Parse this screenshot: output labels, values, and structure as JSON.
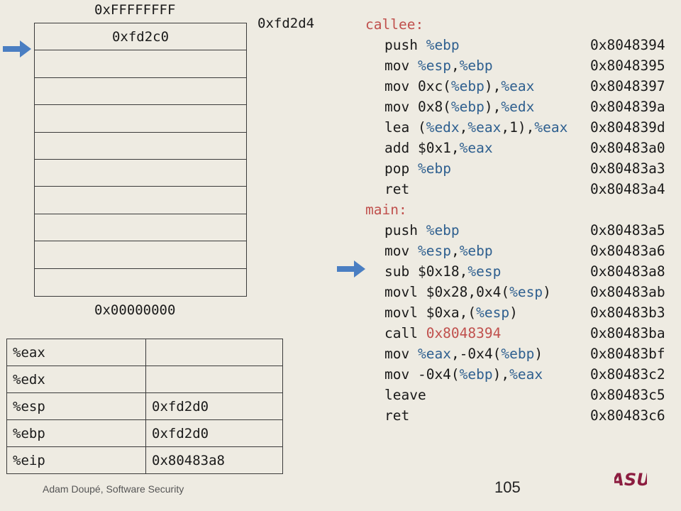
{
  "stack": {
    "top_label": "0xFFFFFFFF",
    "bottom_label": "0x00000000",
    "pointer_label": "0xfd2d4",
    "cells": [
      "0xfd2c0",
      "",
      "",
      "",
      "",
      "",
      "",
      "",
      "",
      ""
    ],
    "arrow_color": "#4a7ec2"
  },
  "registers": [
    {
      "name": "%eax",
      "value": ""
    },
    {
      "name": "%edx",
      "value": ""
    },
    {
      "name": "%esp",
      "value": "0xfd2d0"
    },
    {
      "name": "%ebp",
      "value": "0xfd2d0"
    },
    {
      "name": "%eip",
      "value": "0x80483a8"
    }
  ],
  "code": [
    {
      "type": "label",
      "text": "callee:"
    },
    {
      "type": "instr",
      "parts": [
        [
          "t",
          "push "
        ],
        [
          "r",
          "%ebp"
        ]
      ],
      "addr": "0x8048394"
    },
    {
      "type": "instr",
      "parts": [
        [
          "t",
          "mov "
        ],
        [
          "r",
          "%esp"
        ],
        [
          "t",
          ","
        ],
        [
          "r",
          "%ebp"
        ]
      ],
      "addr": "0x8048395"
    },
    {
      "type": "instr",
      "parts": [
        [
          "t",
          "mov 0xc("
        ],
        [
          "r",
          "%ebp"
        ],
        [
          "t",
          "),"
        ],
        [
          "r",
          "%eax"
        ]
      ],
      "addr": "0x8048397"
    },
    {
      "type": "instr",
      "parts": [
        [
          "t",
          "mov 0x8("
        ],
        [
          "r",
          "%ebp"
        ],
        [
          "t",
          "),"
        ],
        [
          "r",
          "%edx"
        ]
      ],
      "addr": "0x804839a"
    },
    {
      "type": "instr",
      "parts": [
        [
          "t",
          "lea ("
        ],
        [
          "r",
          "%edx"
        ],
        [
          "t",
          ","
        ],
        [
          "r",
          "%eax"
        ],
        [
          "t",
          ",1),"
        ],
        [
          "r",
          "%eax"
        ]
      ],
      "addr": "0x804839d"
    },
    {
      "type": "instr",
      "parts": [
        [
          "t",
          "add $0x1,"
        ],
        [
          "r",
          "%eax"
        ]
      ],
      "addr": "0x80483a0"
    },
    {
      "type": "instr",
      "parts": [
        [
          "t",
          "pop "
        ],
        [
          "r",
          "%ebp"
        ]
      ],
      "addr": "0x80483a3"
    },
    {
      "type": "instr",
      "parts": [
        [
          "t",
          "ret"
        ]
      ],
      "addr": "0x80483a4"
    },
    {
      "type": "label",
      "text": "main:"
    },
    {
      "type": "instr",
      "parts": [
        [
          "t",
          "push "
        ],
        [
          "r",
          "%ebp"
        ]
      ],
      "addr": "0x80483a5"
    },
    {
      "type": "instr",
      "parts": [
        [
          "t",
          "mov "
        ],
        [
          "r",
          "%esp"
        ],
        [
          "t",
          ","
        ],
        [
          "r",
          "%ebp"
        ]
      ],
      "addr": "0x80483a6"
    },
    {
      "type": "instr",
      "parts": [
        [
          "t",
          "sub $0x18,"
        ],
        [
          "r",
          "%esp"
        ]
      ],
      "addr": "0x80483a8",
      "current": true
    },
    {
      "type": "instr",
      "parts": [
        [
          "t",
          "movl $0x28,0x4("
        ],
        [
          "r",
          "%esp"
        ],
        [
          "t",
          ")"
        ]
      ],
      "addr": "0x80483ab"
    },
    {
      "type": "instr",
      "parts": [
        [
          "t",
          "movl $0xa,("
        ],
        [
          "r",
          "%esp"
        ],
        [
          "t",
          ")"
        ]
      ],
      "addr": "0x80483b3"
    },
    {
      "type": "instr",
      "parts": [
        [
          "t",
          "call "
        ],
        [
          "c",
          "0x8048394"
        ]
      ],
      "addr": "0x80483ba"
    },
    {
      "type": "instr",
      "parts": [
        [
          "t",
          "mov "
        ],
        [
          "r",
          "%eax"
        ],
        [
          "t",
          ",-0x4("
        ],
        [
          "r",
          "%ebp"
        ],
        [
          "t",
          ")"
        ]
      ],
      "addr": "0x80483bf"
    },
    {
      "type": "instr",
      "parts": [
        [
          "t",
          "mov -0x4("
        ],
        [
          "r",
          "%ebp"
        ],
        [
          "t",
          "),"
        ],
        [
          "r",
          "%eax"
        ]
      ],
      "addr": "0x80483c2"
    },
    {
      "type": "instr",
      "parts": [
        [
          "t",
          "leave"
        ]
      ],
      "addr": "0x80483c5"
    },
    {
      "type": "instr",
      "parts": [
        [
          "t",
          "ret"
        ]
      ],
      "addr": "0x80483c6"
    }
  ],
  "colors": {
    "register": "#2e5f8f",
    "label": "#c0504d",
    "logo": "#8c1d40"
  },
  "footer": {
    "author": "Adam Doupé, Software Security",
    "page": "105",
    "logo_text": "ASU"
  }
}
